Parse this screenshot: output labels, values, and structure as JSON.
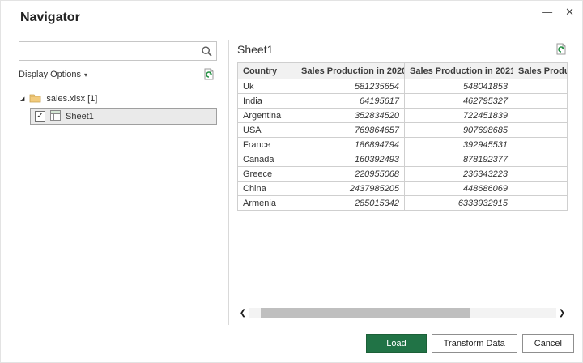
{
  "window": {
    "title": "Navigator"
  },
  "icons": {
    "minimize": "—",
    "close": "✕",
    "chevron_down": "▾",
    "expander_expanded": "◢",
    "check": "✓",
    "scroll_left": "❮",
    "scroll_right": "❯"
  },
  "colors": {
    "load_button_green": "#217346",
    "selected_item_bg": "#eaeaea"
  },
  "left_panel": {
    "search_placeholder": "",
    "display_options_label": "Display Options",
    "tree": {
      "workbook_label": "sales.xlsx [1]",
      "items": [
        {
          "label": "Sheet1",
          "checked": true
        }
      ]
    }
  },
  "preview": {
    "title": "Sheet1",
    "table": {
      "columns": [
        "Country",
        "Sales Production in 2020",
        "Sales Production in 2021",
        "Sales Production"
      ],
      "rows": [
        [
          "Uk",
          "581235654",
          "548041853",
          ""
        ],
        [
          "India",
          "64195617",
          "462795327",
          ""
        ],
        [
          "Argentina",
          "352834520",
          "722451839",
          ""
        ],
        [
          "USA",
          "769864657",
          "907698685",
          ""
        ],
        [
          "France",
          "186894794",
          "392945531",
          ""
        ],
        [
          "Canada",
          "160392493",
          "878192377",
          ""
        ],
        [
          "Greece",
          "220955068",
          "236343223",
          ""
        ],
        [
          "China",
          "2437985205",
          "448686069",
          ""
        ],
        [
          "Armenia",
          "285015342",
          "6333932915",
          ""
        ]
      ]
    }
  },
  "footer": {
    "load_label": "Load",
    "transform_label": "Transform Data",
    "cancel_label": "Cancel"
  }
}
